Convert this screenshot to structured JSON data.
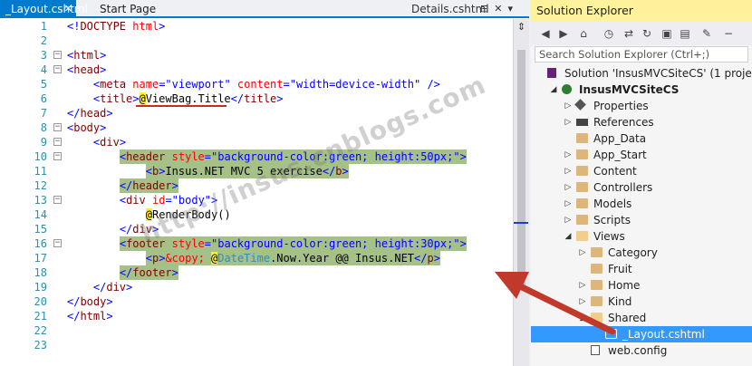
{
  "tabs": {
    "active": {
      "label": "_Layout.cshtml",
      "close_glyph": "✕"
    },
    "start": {
      "label": "Start Page"
    },
    "details": {
      "label": "Details.cshtml"
    }
  },
  "code_lines": [
    {
      "n": "1",
      "indent": 0,
      "tokens": [
        [
          "br",
          "<!"
        ],
        [
          "tag",
          "DOCTYPE"
        ],
        [
          "txt",
          " "
        ],
        [
          "attr",
          "html"
        ],
        [
          "br",
          ">"
        ]
      ]
    },
    {
      "n": "2",
      "indent": 0,
      "tokens": []
    },
    {
      "n": "3",
      "indent": 0,
      "fold": "−",
      "tokens": [
        [
          "br",
          "<"
        ],
        [
          "tag",
          "html"
        ],
        [
          "br",
          ">"
        ]
      ]
    },
    {
      "n": "4",
      "indent": 0,
      "fold": "−",
      "tokens": [
        [
          "br",
          "<"
        ],
        [
          "tag",
          "head"
        ],
        [
          "br",
          ">"
        ]
      ]
    },
    {
      "n": "5",
      "indent": 4,
      "tokens": [
        [
          "br",
          "<"
        ],
        [
          "tag",
          "meta"
        ],
        [
          "txt",
          " "
        ],
        [
          "attr",
          "name"
        ],
        [
          "br",
          "="
        ],
        [
          "val",
          "\"viewport\""
        ],
        [
          "txt",
          " "
        ],
        [
          "attr",
          "content"
        ],
        [
          "br",
          "="
        ],
        [
          "val",
          "\"width=device-width\""
        ],
        [
          "txt",
          " "
        ],
        [
          "br",
          "/>"
        ]
      ]
    },
    {
      "n": "6",
      "indent": 4,
      "tokens": [
        [
          "br",
          "<"
        ],
        [
          "tag",
          "title"
        ],
        [
          "br",
          ">"
        ],
        [
          "at",
          "@"
        ],
        [
          "razor",
          "ViewBag.Title"
        ],
        [
          "br",
          "</"
        ],
        [
          "tag",
          "title"
        ],
        [
          "br",
          ">"
        ]
      ]
    },
    {
      "n": "7",
      "indent": 0,
      "tokens": [
        [
          "br",
          "</"
        ],
        [
          "tag",
          "head"
        ],
        [
          "br",
          ">"
        ]
      ]
    },
    {
      "n": "8",
      "indent": 0,
      "fold": "−",
      "tokens": [
        [
          "br",
          "<"
        ],
        [
          "tag",
          "body"
        ],
        [
          "br",
          ">"
        ]
      ]
    },
    {
      "n": "9",
      "indent": 4,
      "fold": "−",
      "tokens": [
        [
          "br",
          "<"
        ],
        [
          "tag",
          "div"
        ],
        [
          "br",
          ">"
        ]
      ]
    },
    {
      "n": "10",
      "indent": 8,
      "fold": "−",
      "hl": true,
      "tokens": [
        [
          "br",
          "<"
        ],
        [
          "tag",
          "header"
        ],
        [
          "txt",
          " "
        ],
        [
          "attr",
          "style"
        ],
        [
          "br",
          "="
        ],
        [
          "val",
          "\"background-color:green; height:50px;\""
        ],
        [
          "br",
          ">"
        ]
      ]
    },
    {
      "n": "11",
      "indent": 12,
      "hl": true,
      "tokens": [
        [
          "br",
          "<"
        ],
        [
          "tag",
          "b"
        ],
        [
          "br",
          ">"
        ],
        [
          "txt",
          "Insus.NET MVC 5 exercise"
        ],
        [
          "br",
          "</"
        ],
        [
          "tag",
          "b"
        ],
        [
          "br",
          ">"
        ]
      ]
    },
    {
      "n": "12",
      "indent": 8,
      "hl": true,
      "tokens": [
        [
          "br",
          "</"
        ],
        [
          "tag",
          "header"
        ],
        [
          "br",
          ">"
        ]
      ]
    },
    {
      "n": "13",
      "indent": 8,
      "fold": "−",
      "tokens": [
        [
          "br",
          "<"
        ],
        [
          "tag",
          "div"
        ],
        [
          "txt",
          " "
        ],
        [
          "attr",
          "id"
        ],
        [
          "br",
          "="
        ],
        [
          "val",
          "\"body\""
        ],
        [
          "br",
          ">"
        ]
      ]
    },
    {
      "n": "14",
      "indent": 12,
      "tokens": [
        [
          "at",
          "@"
        ],
        [
          "razor",
          "RenderBody()"
        ]
      ]
    },
    {
      "n": "15",
      "indent": 8,
      "tokens": [
        [
          "br",
          "</"
        ],
        [
          "tag",
          "div"
        ],
        [
          "br",
          ">"
        ]
      ]
    },
    {
      "n": "16",
      "indent": 8,
      "fold": "−",
      "hl": true,
      "tokens": [
        [
          "br",
          "<"
        ],
        [
          "tag",
          "footer"
        ],
        [
          "txt",
          " "
        ],
        [
          "attr",
          "style"
        ],
        [
          "br",
          "="
        ],
        [
          "val",
          "\"background-color:green; height:30px;\""
        ],
        [
          "br",
          ">"
        ]
      ]
    },
    {
      "n": "17",
      "indent": 12,
      "hl": true,
      "tokens": [
        [
          "br",
          "<"
        ],
        [
          "tag",
          "p"
        ],
        [
          "br",
          ">"
        ],
        [
          "attr",
          "&copy;"
        ],
        [
          "txt",
          " "
        ],
        [
          "at",
          "@"
        ],
        [
          "type",
          "DateTime"
        ],
        [
          "razor",
          ".Now.Year @@ Insus.NET"
        ],
        [
          "br",
          "</"
        ],
        [
          "tag",
          "p"
        ],
        [
          "br",
          ">"
        ]
      ]
    },
    {
      "n": "18",
      "indent": 8,
      "hl": true,
      "tokens": [
        [
          "br",
          "</"
        ],
        [
          "tag",
          "footer"
        ],
        [
          "br",
          ">"
        ]
      ]
    },
    {
      "n": "19",
      "indent": 4,
      "tokens": [
        [
          "br",
          "</"
        ],
        [
          "tag",
          "div"
        ],
        [
          "br",
          ">"
        ]
      ]
    },
    {
      "n": "20",
      "indent": 0,
      "tokens": [
        [
          "br",
          "</"
        ],
        [
          "tag",
          "body"
        ],
        [
          "br",
          ">"
        ]
      ]
    },
    {
      "n": "21",
      "indent": 0,
      "tokens": [
        [
          "br",
          "</"
        ],
        [
          "tag",
          "html"
        ],
        [
          "br",
          ">"
        ]
      ]
    },
    {
      "n": "22",
      "indent": 0,
      "tokens": []
    },
    {
      "n": "23",
      "indent": 0,
      "tokens": []
    }
  ],
  "watermark": "http://insus.cnblogs.com",
  "solution_explorer": {
    "title": "Solution Explorer",
    "search_placeholder": "Search Solution Explorer (Ctrl+;)",
    "toolbar_icons": [
      "back-icon",
      "forward-icon",
      "home-icon",
      "history-icon",
      "sync-icon",
      "refresh-icon",
      "collapse-all-icon",
      "show-files-icon",
      "properties-icon"
    ],
    "nodes": [
      {
        "label": "Solution 'InsusMVCSiteCS' (1 project)",
        "level": 0,
        "arrow": "",
        "icon": "solution-icon"
      },
      {
        "label": "InsusMVCSiteCS",
        "level": 1,
        "arrow": "◢",
        "icon": "web-project-icon",
        "bold": true
      },
      {
        "label": "Properties",
        "level": 2,
        "arrow": "▷",
        "icon": "wrench-icon"
      },
      {
        "label": "References",
        "level": 2,
        "arrow": "▷",
        "icon": "references-icon"
      },
      {
        "label": "App_Data",
        "level": 2,
        "arrow": "",
        "icon": "folder-icon"
      },
      {
        "label": "App_Start",
        "level": 2,
        "arrow": "▷",
        "icon": "folder-icon"
      },
      {
        "label": "Content",
        "level": 2,
        "arrow": "▷",
        "icon": "folder-icon"
      },
      {
        "label": "Controllers",
        "level": 2,
        "arrow": "▷",
        "icon": "folder-icon"
      },
      {
        "label": "Models",
        "level": 2,
        "arrow": "▷",
        "icon": "folder-icon"
      },
      {
        "label": "Scripts",
        "level": 2,
        "arrow": "▷",
        "icon": "folder-icon"
      },
      {
        "label": "Views",
        "level": 2,
        "arrow": "◢",
        "icon": "folder-open-icon"
      },
      {
        "label": "Category",
        "level": 3,
        "arrow": "▷",
        "icon": "folder-icon"
      },
      {
        "label": "Fruit",
        "level": 3,
        "arrow": "",
        "icon": "folder-icon"
      },
      {
        "label": "Home",
        "level": 3,
        "arrow": "▷",
        "icon": "folder-icon"
      },
      {
        "label": "Kind",
        "level": 3,
        "arrow": "▷",
        "icon": "folder-icon"
      },
      {
        "label": "Shared",
        "level": 3,
        "arrow": "◢",
        "icon": "folder-open-icon"
      },
      {
        "label": "_Layout.cshtml",
        "level": 4,
        "arrow": "",
        "icon": "razor-file-icon",
        "selected": true
      },
      {
        "label": "web.config",
        "level": 3,
        "arrow": "",
        "icon": "config-file-icon"
      }
    ]
  },
  "colors": {
    "accent": "#007acc",
    "selection": "#3399ff",
    "highlight": "#a6c188",
    "annotation_arrow": "#c0392b"
  }
}
